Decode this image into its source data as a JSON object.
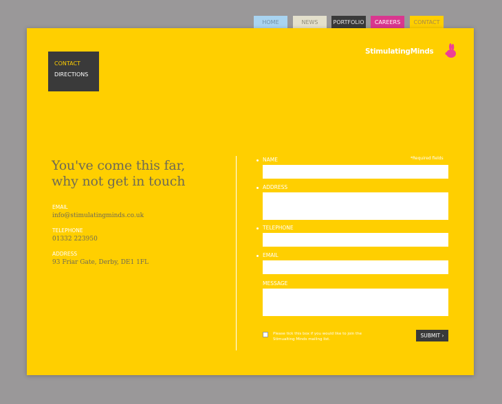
{
  "nav": {
    "home": "HOME",
    "news": "NEWS",
    "portfolio": "PORTFOLIO",
    "careers": "CAREERS",
    "contact": "CONTACT"
  },
  "submenu": {
    "contact": "CONTACT",
    "directions": "DIRECTIONS"
  },
  "logo": {
    "text": "StimulatingMinds"
  },
  "headline": {
    "line1": "You've come this far,",
    "line2": "why not get in touch"
  },
  "contact_info": {
    "email_label": "EMAIL",
    "email_value": "info@stimulatingminds.co.uk",
    "telephone_label": "TELEPHONE",
    "telephone_value": "01332 223950",
    "address_label": "ADDRESS",
    "address_value": "93 Friar Gate, Derby, DE1 1FL"
  },
  "form": {
    "required_note": "*Required fields",
    "name_label": "NAME",
    "address_label": "ADDRESS",
    "telephone_label": "TELEPHONE",
    "email_label": "EMAIL",
    "message_label": "MESSAGE",
    "name_value": "",
    "address_value": "",
    "telephone_value": "",
    "email_value": "",
    "message_value": "",
    "mailing_list_text": "Please tick this box  if you would like to join the Stimualting Minds mailing list.",
    "submit_label": "SUBMIT ›"
  },
  "colors": {
    "panel": "#ffcf00",
    "dark": "#3a3a3a",
    "home_tab": "#a9d4f1",
    "news_tab": "#e4e0cc",
    "careers_tab": "#d9378f",
    "rabbit": "#ee3f96"
  }
}
